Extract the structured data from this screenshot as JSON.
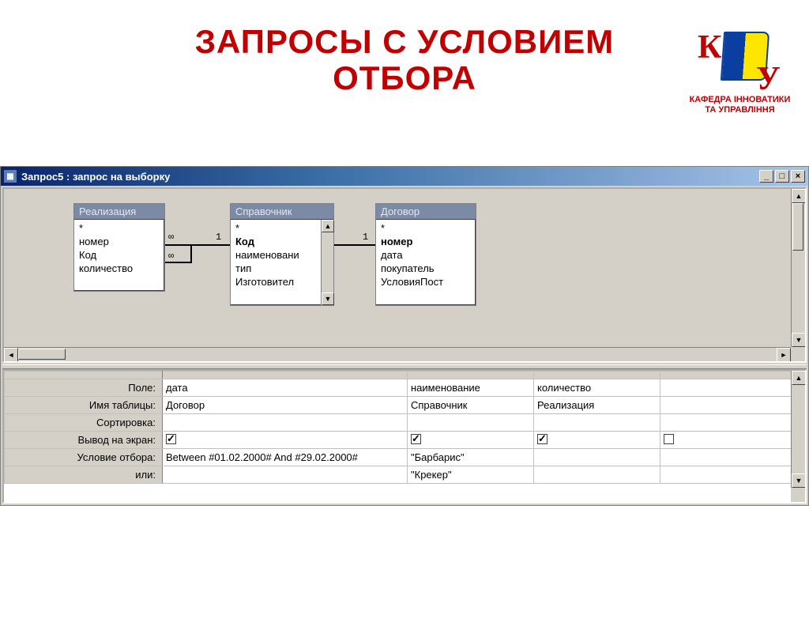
{
  "slide": {
    "title_line1": "ЗАПРОСЫ С УСЛОВИЕМ",
    "title_line2": "ОТБОРА"
  },
  "logo": {
    "text_line1": "КАФЕДРА ІННОВАТИКИ",
    "text_line2": "ТА УПРАВЛІННЯ"
  },
  "window": {
    "title": "Запрос5 : запрос на выборку"
  },
  "tables": [
    {
      "name": "Реализация",
      "fields": [
        "*",
        "номер",
        "Код",
        "количество"
      ],
      "bold": []
    },
    {
      "name": "Справочник",
      "fields": [
        "*",
        "Код",
        "наименовани",
        "тип",
        "Изготовител"
      ],
      "bold": [
        "Код"
      ]
    },
    {
      "name": "Договор",
      "fields": [
        "*",
        "номер",
        "дата",
        "покупатель",
        "УсловияПост"
      ],
      "bold": [
        "номер"
      ]
    }
  ],
  "joins": {
    "r1_left": "∞",
    "r1_right": "1",
    "r2_left": "∞",
    "r2_right": "",
    "r3_right": "1"
  },
  "grid": {
    "row_labels": [
      "Поле:",
      "Имя таблицы:",
      "Сортировка:",
      "Вывод на экран:",
      "Условие отбора:",
      "или:"
    ],
    "columns": [
      {
        "field": "дата",
        "table": "Договор",
        "sort": "",
        "show": true,
        "criteria": "Between #01.02.2000# And #29.02.2000#",
        "or": ""
      },
      {
        "field": "наименование",
        "table": "Справочник",
        "sort": "",
        "show": true,
        "criteria": "\"Барбарис\"",
        "or": "\"Крекер\""
      },
      {
        "field": "количество",
        "table": "Реализация",
        "sort": "",
        "show": true,
        "criteria": "",
        "or": ""
      }
    ]
  }
}
